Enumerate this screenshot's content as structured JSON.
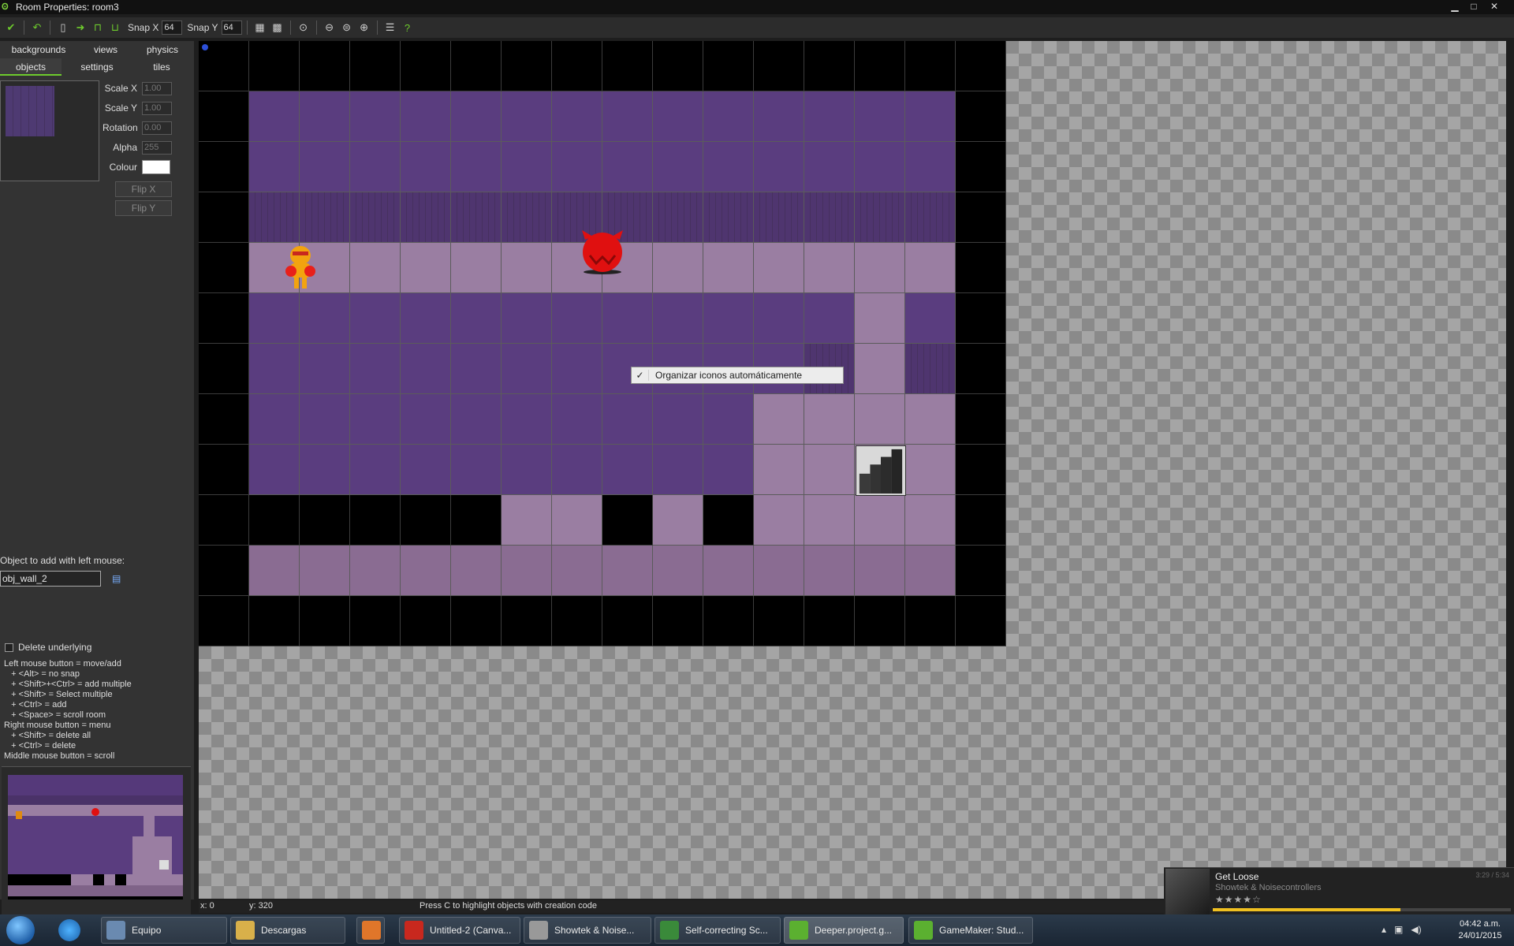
{
  "window": {
    "title": "Room Properties: room3"
  },
  "toolbar": {
    "snap_x_label": "Snap X",
    "snap_x_value": "64",
    "snap_y_label": "Snap Y",
    "snap_y_value": "64"
  },
  "tabs": {
    "backgrounds": "backgrounds",
    "views": "views",
    "physics": "physics",
    "objects": "objects",
    "settings": "settings",
    "tiles": "tiles"
  },
  "properties": {
    "scale_x_label": "Scale X",
    "scale_x": "1.00",
    "scale_y_label": "Scale Y",
    "scale_y": "1.00",
    "rotation_label": "Rotation",
    "rotation": "0.00",
    "alpha_label": "Alpha",
    "alpha": "255",
    "colour_label": "Colour",
    "colour": "#ffffff",
    "flip_x": "Flip X",
    "flip_y": "Flip Y"
  },
  "object_add": {
    "label": "Object to add with left mouse:",
    "value": "obj_wall_2"
  },
  "delete_underlying": {
    "label": "Delete underlying",
    "checked": false
  },
  "help_lines": [
    "Left mouse button = move/add",
    "   + <Alt> = no snap",
    "   + <Shift>+<Ctrl> = add multiple",
    "   + <Shift> = Select multiple",
    "   + <Ctrl> = add",
    "   + <Space> = scroll room",
    "Right mouse button = menu",
    "   + <Shift> = delete all",
    "   + <Ctrl> = delete",
    "Middle mouse button = scroll"
  ],
  "context_menu": {
    "item": "Organizar iconos automáticamente",
    "checked": true
  },
  "status": {
    "x": "x: 0",
    "y": "y: 320",
    "hint": "Press C to highlight objects with creation code"
  },
  "room_map": [
    "BBBBBBBBBBBBBBBB",
    "BPPPPPPPPPPPPPPB",
    "BPPPPPPPPPPPPPPB",
    "BWWWWWWWWWWWWWWB",
    "BFFFFFFFFFFFFFFB",
    "BPPPPPPPPPPPPFPB",
    "BPPPPPPPPPPPWFWB",
    "BPPPPPPPPPPFFFFB",
    "BPPPPPPPPPPFFFFB",
    "BBBBBBFFBFBFFFFB",
    "BLLLLLLLLLLLLLLB",
    "BBBBBBBBBBBBBBBB"
  ],
  "taskbar": {
    "items": [
      {
        "label": "Equipo",
        "icon": "computer-icon",
        "color": "#6a8ab0"
      },
      {
        "label": "Descargas",
        "icon": "folder-icon",
        "color": "#d8b04a"
      },
      {
        "label": "",
        "icon": "media-player-icon",
        "color": "#e0762a"
      },
      {
        "label": "Untitled-2 (Canva...",
        "icon": "flash-icon",
        "color": "#c8281e"
      },
      {
        "label": "Showtek & Noise...",
        "icon": "music-player-icon",
        "color": "#999999"
      },
      {
        "label": "Self-correcting Sc...",
        "icon": "chrome-icon",
        "color": "#3a8a3a"
      },
      {
        "label": "Deeper.project.g...",
        "icon": "gamemaker-icon",
        "color": "#5bb030"
      },
      {
        "label": "GameMaker: Stud...",
        "icon": "gamemaker-icon",
        "color": "#5bb030"
      }
    ],
    "clock_time": "04:42 a.m.",
    "clock_date": "24/01/2015"
  },
  "music": {
    "title": "Get Loose",
    "artist": "Showtek & Noisecontrollers",
    "time": "3:29 / 5:34",
    "rating": 4,
    "progress": 0.63
  }
}
